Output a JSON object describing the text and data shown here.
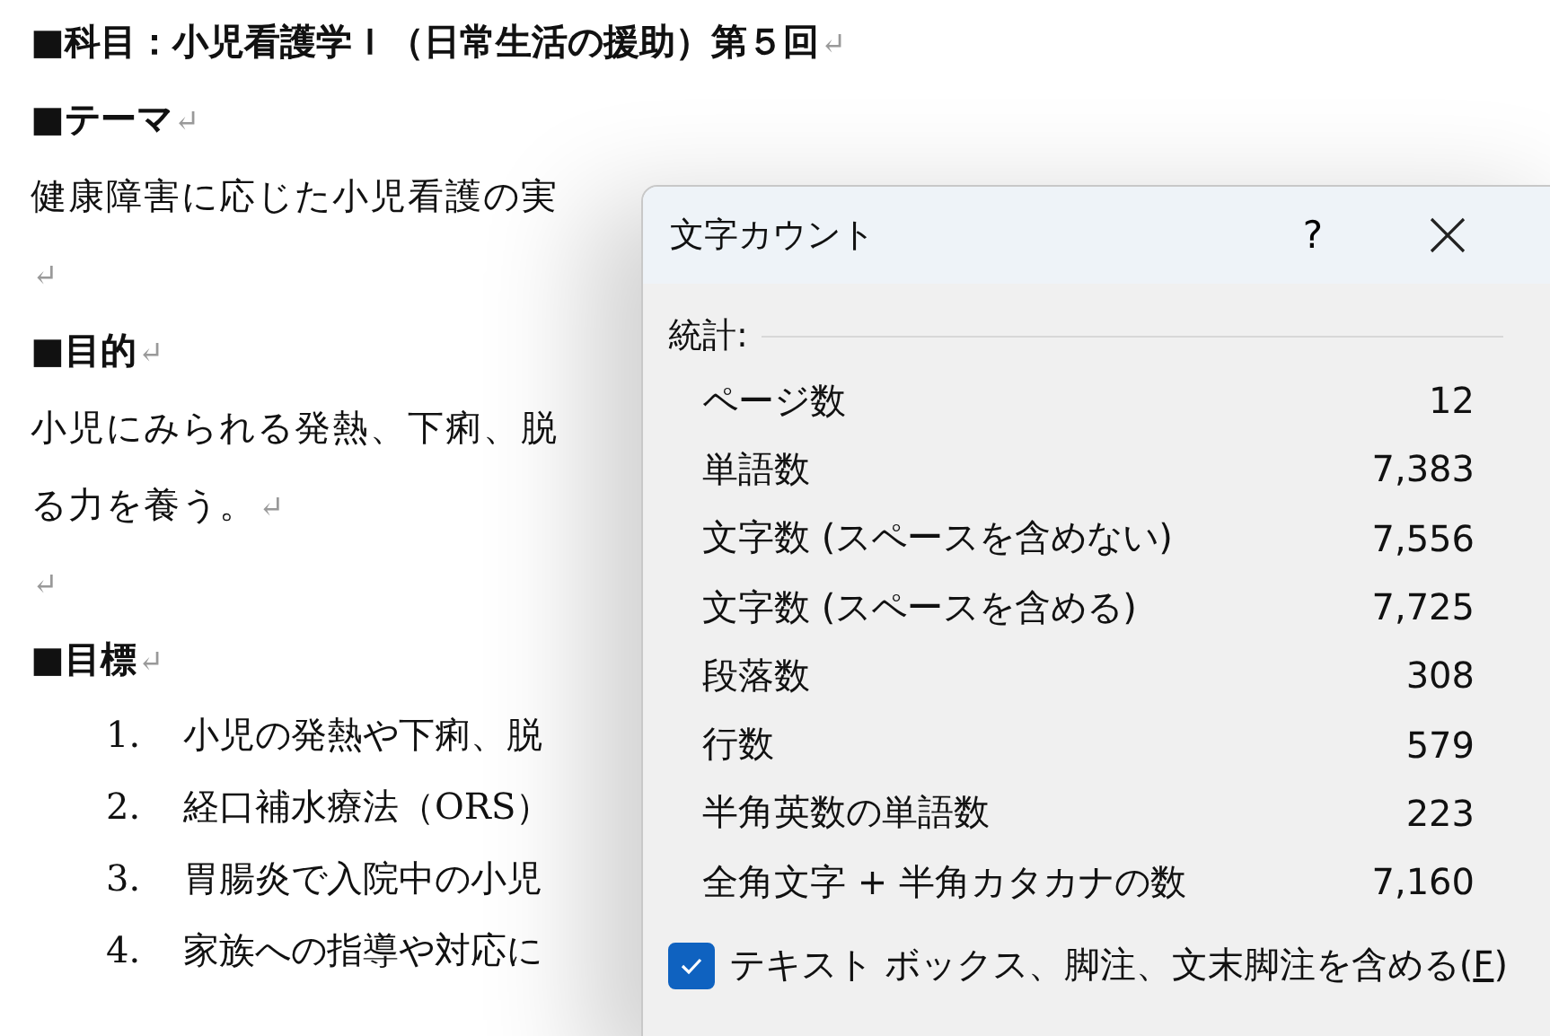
{
  "document": {
    "lines": [
      {
        "kind": "heading",
        "text": "■科目：小児看護学Ｉ（日常生活の援助）第５回",
        "mark": "↵"
      },
      {
        "kind": "heading",
        "text": "■テーマ",
        "mark": "↵"
      },
      {
        "kind": "body",
        "text": "健康障害に応じた小児看護の実"
      },
      {
        "kind": "body",
        "mark": "↵"
      },
      {
        "kind": "heading",
        "text": "■目的",
        "mark": "↵"
      },
      {
        "kind": "body",
        "text": "小児にみられる発熱、下痢、脱"
      },
      {
        "kind": "body",
        "text": "る力を養う。",
        "mark": "↵"
      },
      {
        "kind": "body",
        "mark": "↵"
      },
      {
        "kind": "heading",
        "text": "■目標",
        "mark": "↵"
      },
      {
        "kind": "item",
        "number": "1.",
        "text": "小児の発熱や下痢、脱"
      },
      {
        "kind": "item",
        "number": "2.",
        "text": "経口補水療法（ORS）"
      },
      {
        "kind": "item",
        "number": "3.",
        "text": "胃腸炎で入院中の小児"
      },
      {
        "kind": "item",
        "number": "4.",
        "text": "家族への指導や対応に"
      }
    ]
  },
  "dialog": {
    "title": "文字カウント",
    "help": "?",
    "section": "統計:",
    "stats": [
      {
        "label": "ページ数",
        "value": "12"
      },
      {
        "label": "単語数",
        "value": "7,383"
      },
      {
        "label": "文字数 (スペースを含めない)",
        "value": "7,556"
      },
      {
        "label": "文字数 (スペースを含める)",
        "value": "7,725"
      },
      {
        "label": "段落数",
        "value": "308"
      },
      {
        "label": "行数",
        "value": "579"
      },
      {
        "label": "半角英数の単語数",
        "value": "223"
      },
      {
        "label": "全角文字 + 半角カタカナの数",
        "value": "7,160"
      }
    ],
    "option": {
      "label_before": "テキスト ボックス、脚注、文末脚注を含める(",
      "access_key": "F",
      "label_after": ")",
      "checked": true
    }
  }
}
